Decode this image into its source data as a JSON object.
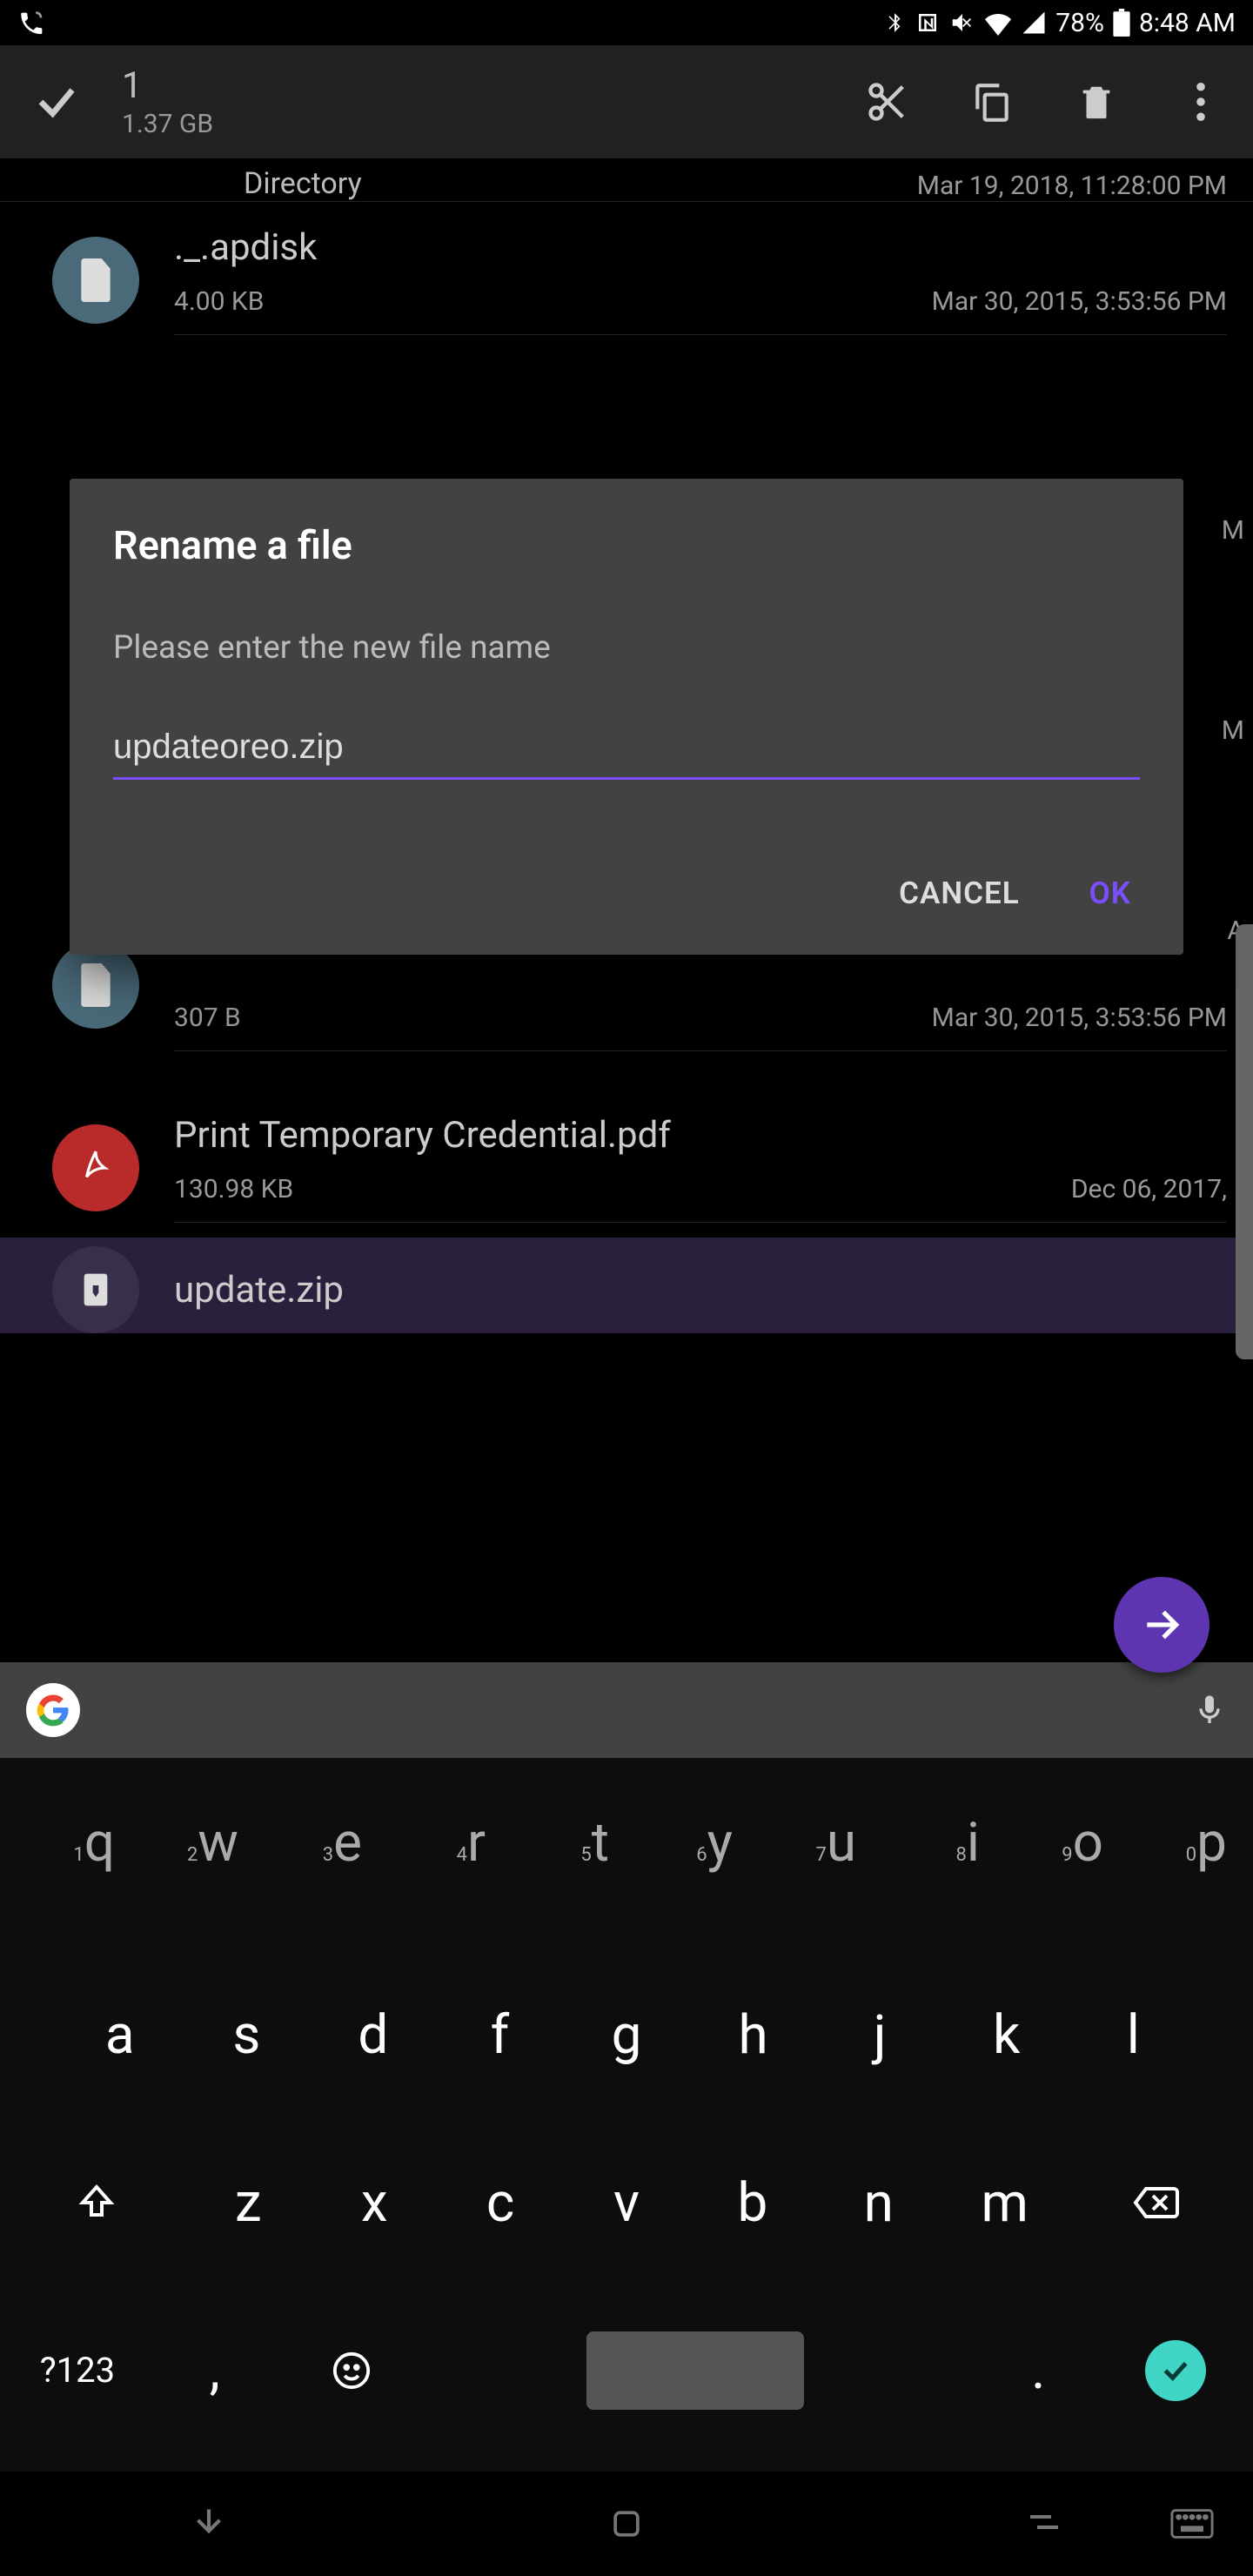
{
  "status": {
    "battery": "78%",
    "time": "8:48 AM"
  },
  "actionbar": {
    "count": "1",
    "size": "1.37 GB"
  },
  "partial_top": {
    "name": "Directory",
    "date": "Mar 19, 2018, 11:28:00 PM"
  },
  "files": [
    {
      "name": "._.apdisk",
      "size": "4.00 KB",
      "date": "Mar 30, 2015, 3:53:56 PM",
      "icon": "file"
    },
    {
      "name": "",
      "size": "307 B",
      "date": "Mar 30, 2015, 3:53:56 PM",
      "icon": "file"
    },
    {
      "name": "Print Temporary Credential.pdf",
      "size": "130.98 KB",
      "date": "Dec 06, 2017,",
      "icon": "pdf"
    },
    {
      "name": "update.zip",
      "size": "",
      "date": "",
      "icon": "zip",
      "selected": true
    }
  ],
  "dialog": {
    "title": "Rename a file",
    "message": "Please enter the new file name",
    "input": "updateoreo.zip",
    "cancel": "CANCEL",
    "ok": "OK"
  },
  "keyboard": {
    "sym": "?123",
    "row1": [
      {
        "c": "q",
        "n": "1"
      },
      {
        "c": "w",
        "n": "2"
      },
      {
        "c": "e",
        "n": "3"
      },
      {
        "c": "r",
        "n": "4"
      },
      {
        "c": "t",
        "n": "5"
      },
      {
        "c": "y",
        "n": "6"
      },
      {
        "c": "u",
        "n": "7"
      },
      {
        "c": "i",
        "n": "8"
      },
      {
        "c": "o",
        "n": "9"
      },
      {
        "c": "p",
        "n": "0"
      }
    ],
    "row2": [
      "a",
      "s",
      "d",
      "f",
      "g",
      "h",
      "j",
      "k",
      "l"
    ],
    "row3": [
      "z",
      "x",
      "c",
      "v",
      "b",
      "n",
      "m"
    ],
    "comma": ",",
    "period": "."
  },
  "edge_letters": [
    "M",
    "M",
    "A"
  ]
}
